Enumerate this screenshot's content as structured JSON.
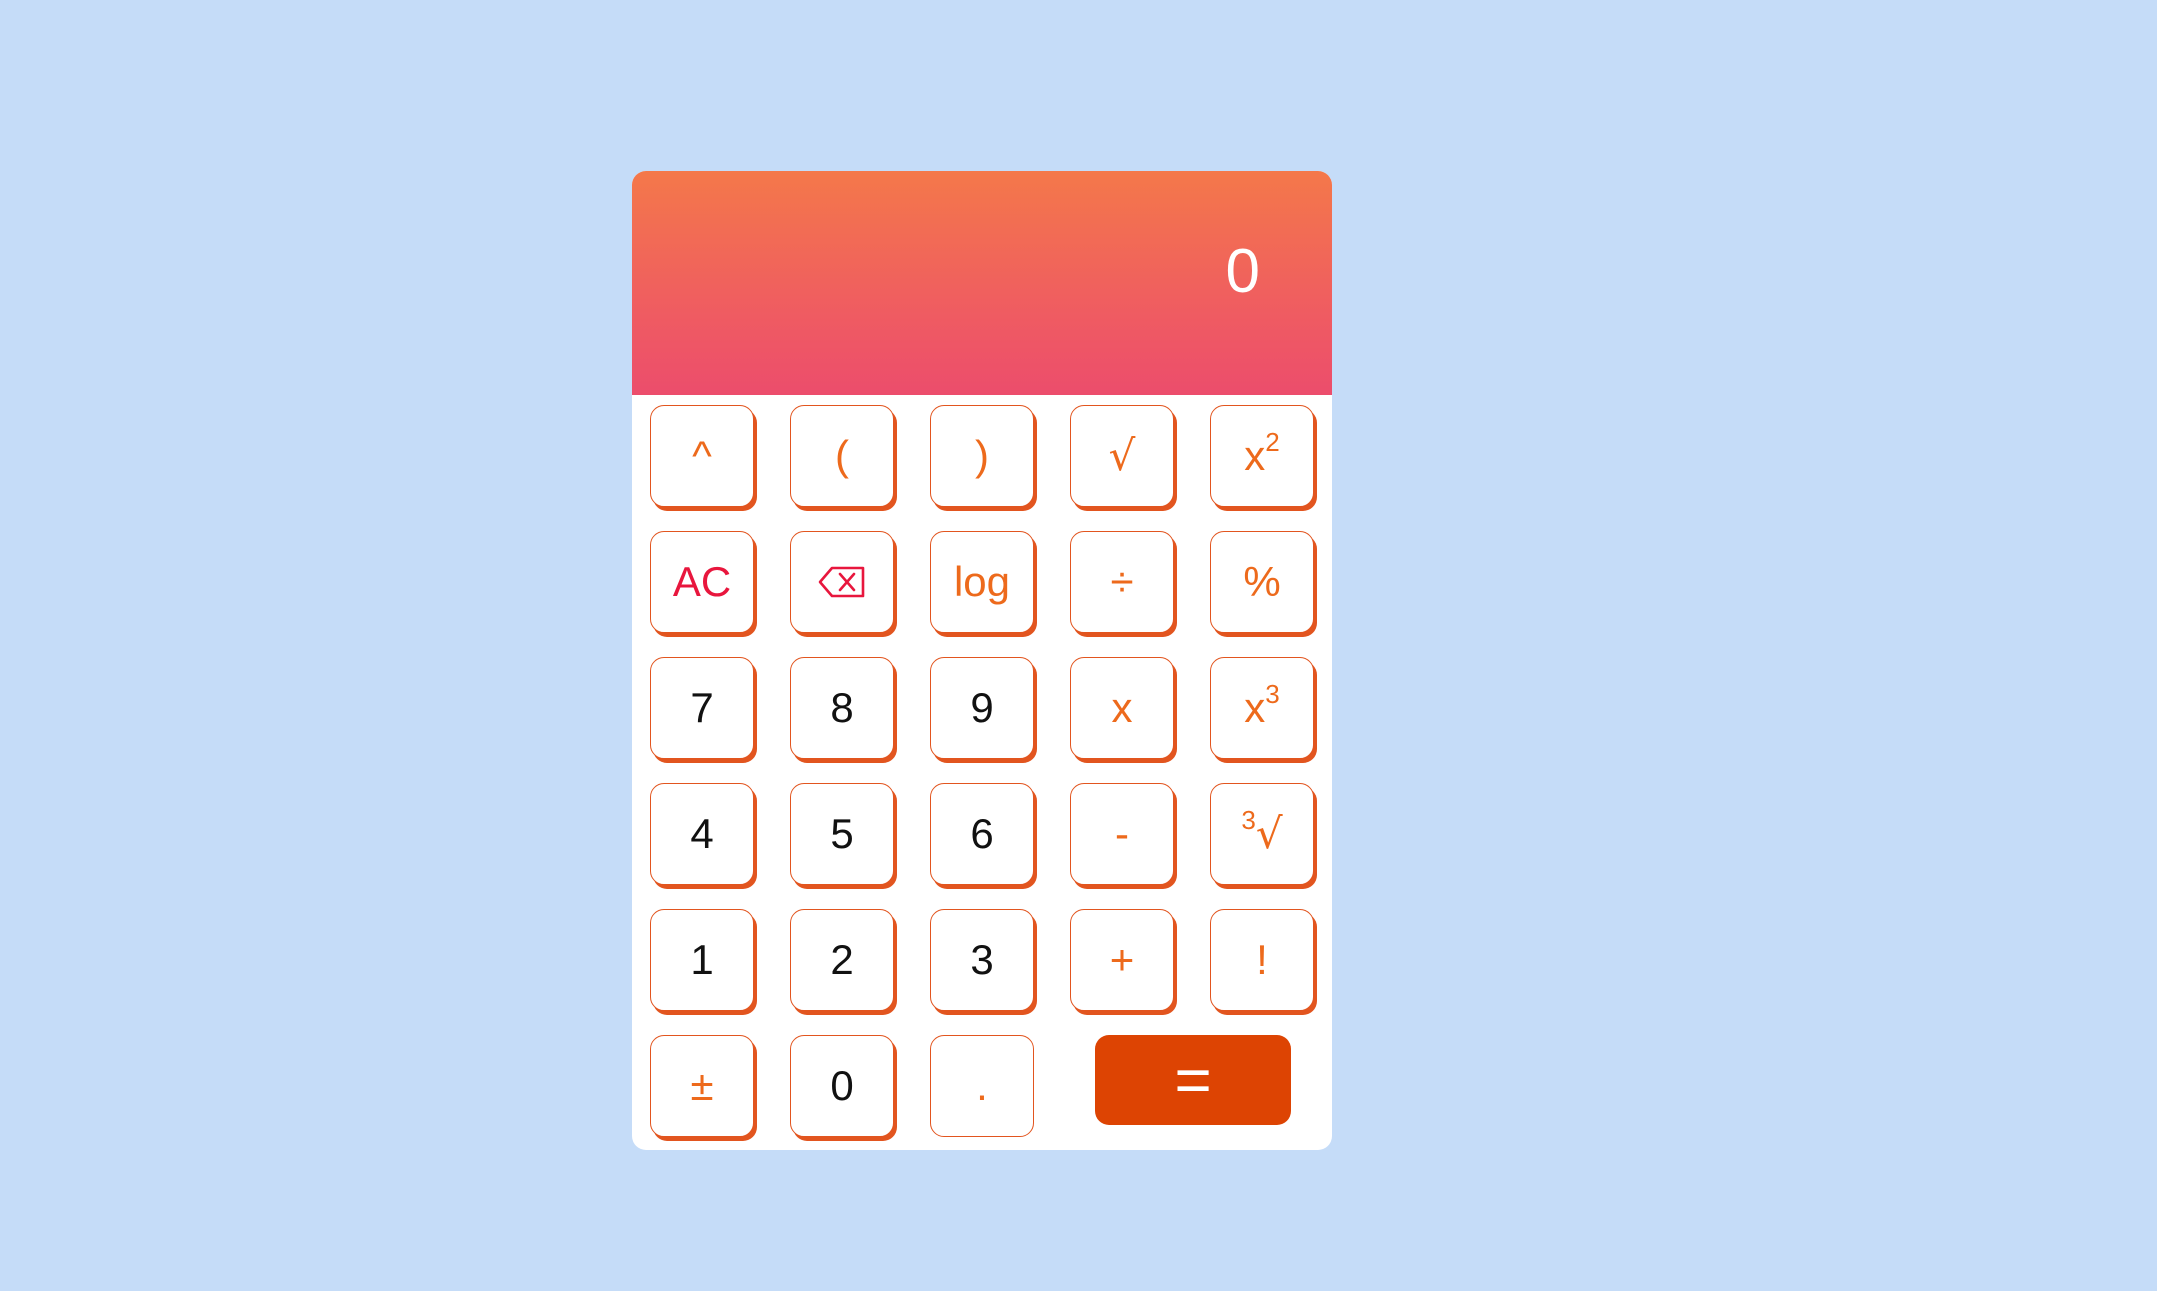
{
  "display": {
    "value": "0"
  },
  "keys": {
    "power": "^",
    "open_paren": "(",
    "close_paren": ")",
    "sqrt": "√",
    "square_base": "x",
    "square_exp": "2",
    "clear": "AC",
    "log": "log",
    "divide": "÷",
    "percent": "%",
    "seven": "7",
    "eight": "8",
    "nine": "9",
    "multiply": "x",
    "cube_base": "x",
    "cube_exp": "3",
    "four": "4",
    "five": "5",
    "six": "6",
    "minus": "-",
    "cbrt_index": "3",
    "cbrt_sign": "√",
    "one": "1",
    "two": "2",
    "three": "3",
    "plus": "+",
    "factorial": "!",
    "plus_minus": "±",
    "zero": "0",
    "decimal": ".",
    "equals": "="
  },
  "icons": {
    "backspace": "backspace-icon"
  },
  "colors": {
    "page_background": "#c5dcf8",
    "display_top": "#f4784a",
    "display_bottom": "#ec4d6c",
    "key_border": "#e2551f",
    "operator_text": "#ed6a1c",
    "clear_text": "#e8163d",
    "equals_background": "#dd4403"
  }
}
